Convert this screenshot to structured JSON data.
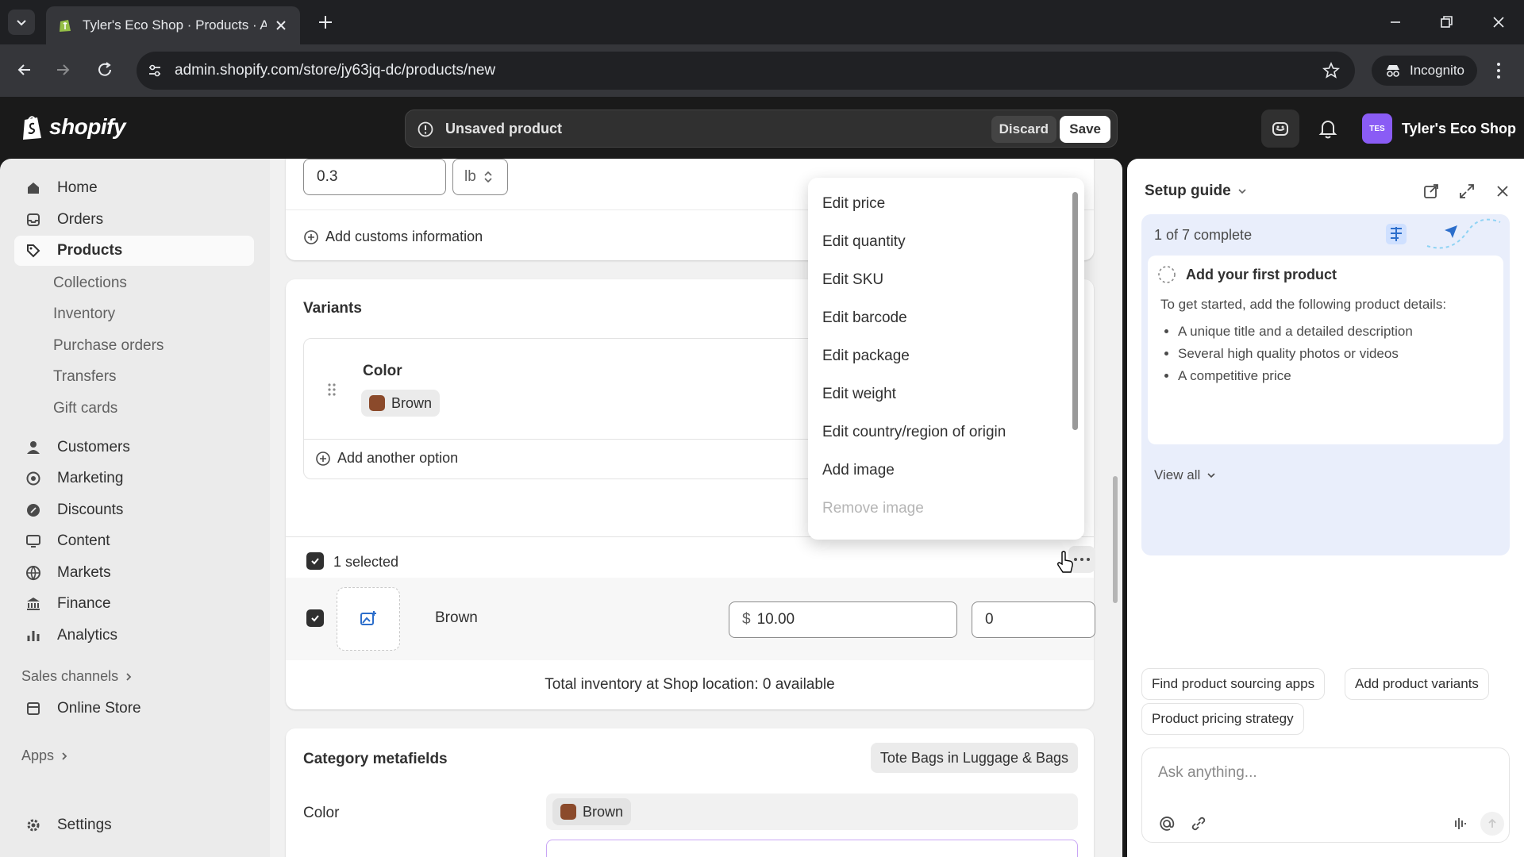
{
  "browser": {
    "tab_title": "Tyler's Eco Shop · Products · Ad",
    "url": "admin.shopify.com/store/jy63jq-dc/products/new",
    "incognito_label": "Incognito"
  },
  "topbar": {
    "brand": "shopify",
    "status_message": "Unsaved product",
    "discard_label": "Discard",
    "save_label": "Save",
    "store_initials": "TES",
    "store_name": "Tyler's Eco Shop"
  },
  "sidebar": {
    "items": [
      {
        "label": "Home",
        "icon": "home-icon"
      },
      {
        "label": "Orders",
        "icon": "orders-icon"
      },
      {
        "label": "Products",
        "icon": "tag-icon",
        "active": true
      }
    ],
    "product_subitems": [
      "Collections",
      "Inventory",
      "Purchase orders",
      "Transfers",
      "Gift cards"
    ],
    "more_items": [
      "Customers",
      "Marketing",
      "Discounts",
      "Content",
      "Markets",
      "Finance",
      "Analytics"
    ],
    "sales_channels_label": "Sales channels",
    "online_store_label": "Online Store",
    "apps_label": "Apps",
    "settings_label": "Settings"
  },
  "shipping": {
    "weight_value": "0.3",
    "weight_unit": "lb",
    "add_customs_label": "Add customs information"
  },
  "variants": {
    "heading": "Variants",
    "option_name": "Color",
    "option_value": "Brown",
    "add_option_label": "Add another option",
    "selected_label": "1 selected",
    "row": {
      "name": "Brown",
      "currency": "$",
      "price": "10.00",
      "quantity": "0"
    },
    "total_inventory": "Total inventory at Shop location: 0 available"
  },
  "metafields": {
    "heading": "Category metafields",
    "category_badge": "Tote Bags in Luggage & Bags",
    "color_label": "Color",
    "color_value": "Brown"
  },
  "dropdown": {
    "items": [
      "Edit price",
      "Edit quantity",
      "Edit SKU",
      "Edit barcode",
      "Edit package",
      "Edit weight",
      "Edit country/region of origin",
      "Add image"
    ],
    "disabled_item": "Remove image"
  },
  "setup_guide": {
    "title": "Setup guide",
    "progress": "1 of 7 complete",
    "task_title": "Add your first product",
    "task_description": "To get started, add the following product details:",
    "bullets": [
      "A unique title and a detailed description",
      "Several high quality photos or videos",
      "A competitive price"
    ],
    "view_all_label": "View all",
    "suggestions": [
      "Find product sourcing apps",
      "Add product variants",
      "Product pricing strategy"
    ],
    "ask_placeholder": "Ask anything..."
  },
  "colors": {
    "swatch_brown": "#8b4a2b",
    "store_avatar": "#8a5cf5",
    "guide_bg": "#e9eefb"
  }
}
